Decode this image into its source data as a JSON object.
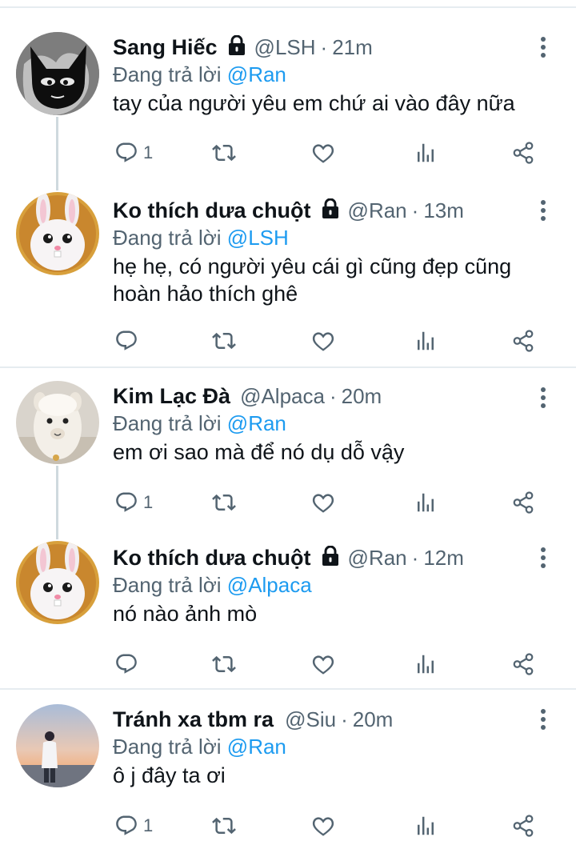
{
  "reply_prefix": "Đang trả lời",
  "tweets": [
    {
      "name": "Sang Hiếc",
      "locked": true,
      "handle": "@LSH",
      "time": "21m",
      "reply_to": "@Ran",
      "text": "tay của người yêu em chứ ai vào đây nữa",
      "reply_count": "1",
      "avatar": "black-cat-avatar"
    },
    {
      "name": "Ko thích dưa chuột",
      "locked": true,
      "handle": "@Ran",
      "time": "13m",
      "reply_to": "@LSH",
      "text": "hẹ hẹ, có người yêu cái gì cũng đẹp cũng hoàn hảo thích ghê",
      "reply_count": "",
      "avatar": "bunny-avatar"
    },
    {
      "name": "Kim Lạc Đà",
      "locked": false,
      "handle": "@Alpaca",
      "time": "20m",
      "reply_to": "@Ran",
      "text": "em ơi sao mà để nó dụ dỗ vậy",
      "reply_count": "1",
      "avatar": "alpaca-avatar"
    },
    {
      "name": "Ko thích dưa chuột",
      "locked": true,
      "handle": "@Ran",
      "time": "12m",
      "reply_to": "@Alpaca",
      "text": "nó nào ảnh mò",
      "reply_count": "",
      "avatar": "bunny-avatar"
    },
    {
      "name": "Tránh xa tbm ra",
      "locked": false,
      "handle": "@Siu",
      "time": "20m",
      "reply_to": "@Ran",
      "text": "ô j đây ta ơi",
      "reply_count": "1",
      "avatar": "sunset-person-avatar"
    }
  ],
  "icons": {
    "reply": "reply-icon",
    "retweet": "retweet-icon",
    "like": "heart-icon",
    "stats": "stats-icon",
    "share": "share-icon",
    "more": "more-icon",
    "lock": "lock-icon"
  },
  "colors": {
    "mention": "#1d9bf0",
    "secondary": "#536471",
    "primary_text": "#0f1419",
    "divider": "#e6ecf0"
  }
}
